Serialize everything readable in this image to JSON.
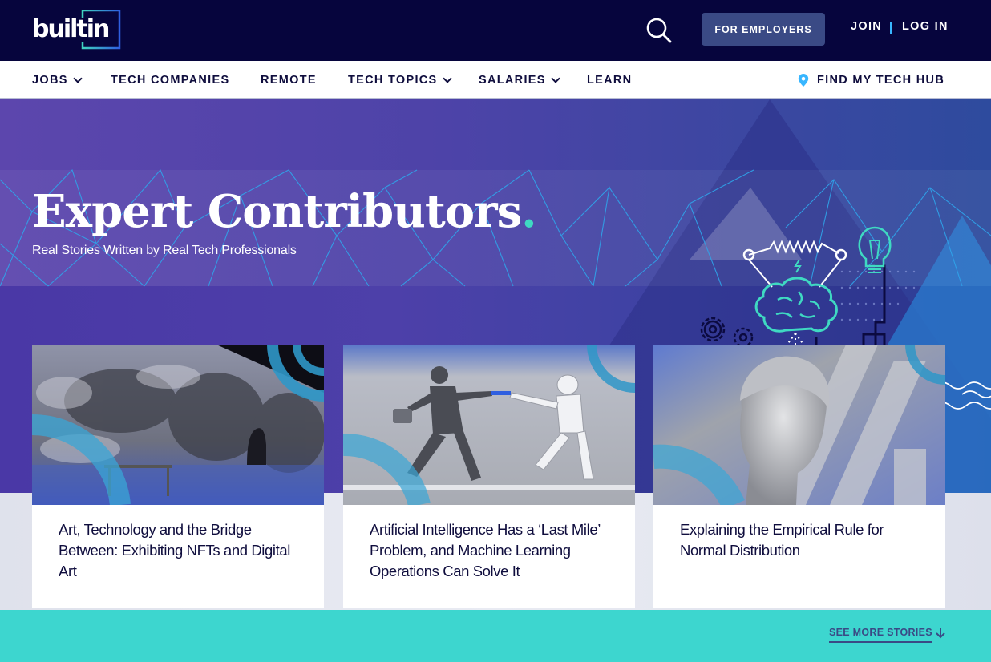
{
  "header": {
    "logo_text": "builtin",
    "search_icon": "search-icon",
    "for_employers": "FOR EMPLOYERS",
    "join": "JOIN",
    "login": "LOG IN"
  },
  "nav": {
    "items": [
      {
        "label": "JOBS",
        "has_dropdown": true
      },
      {
        "label": "TECH COMPANIES",
        "has_dropdown": false
      },
      {
        "label": "REMOTE",
        "has_dropdown": false
      },
      {
        "label": "TECH TOPICS",
        "has_dropdown": true
      },
      {
        "label": "SALARIES",
        "has_dropdown": true
      },
      {
        "label": "LEARN",
        "has_dropdown": false
      }
    ],
    "tech_hub": "FIND MY TECH HUB",
    "tech_hub_icon": "map-pin-icon"
  },
  "hero": {
    "title": "Expert Contributors",
    "title_dot": ".",
    "subtitle": "Real Stories Written by Real Tech Professionals",
    "illustration": "brain-lightbulb-gears-illustration"
  },
  "cards": [
    {
      "title": "Art, Technology and the Bridge Between: Exhibiting NFTs and Digital Art",
      "image": "immersive-van-gogh-exhibit-photo"
    },
    {
      "title": "Artificial Intelligence Has a ‘Last Mile’ Problem, and Machine Learning Operations Can Solve It",
      "image": "businessman-passing-baton-to-robot-illustration"
    },
    {
      "title": "Explaining the Empirical Rule for Normal Distribution",
      "image": "roman-bust-statue-photo"
    }
  ],
  "footer": {
    "see_more": "SEE MORE STORIES",
    "arrow_icon": "arrow-down-icon"
  },
  "colors": {
    "topbar": "#06053d",
    "nav_text": "#0f0d3d",
    "accent_teal": "#3dd6cf",
    "employer_button": "#3a4a85",
    "divider_blue": "#38b6ff"
  }
}
